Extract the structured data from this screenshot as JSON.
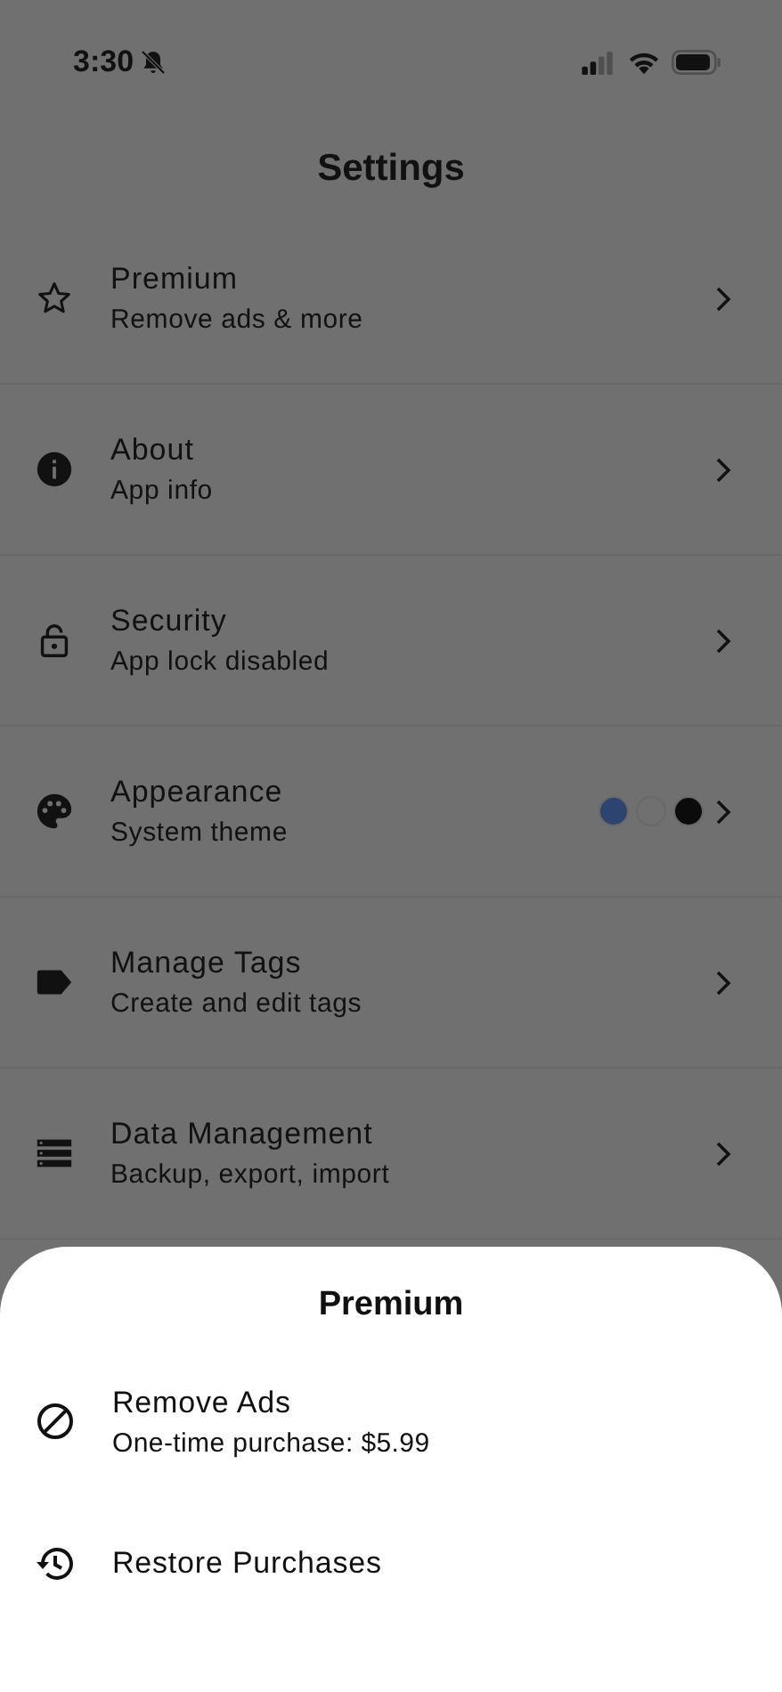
{
  "status_bar": {
    "time": "3:30"
  },
  "title": "Settings",
  "items": [
    {
      "title": "Premium",
      "subtitle": "Remove ads & more"
    },
    {
      "title": "About",
      "subtitle": "App info"
    },
    {
      "title": "Security",
      "subtitle": "App lock disabled"
    },
    {
      "title": "Appearance",
      "subtitle": "System theme",
      "swatches": [
        {
          "color": "#2e4470"
        },
        {
          "color": "#6f706f"
        },
        {
          "color": "#0b0b0b"
        }
      ]
    },
    {
      "title": "Manage Tags",
      "subtitle": "Create and edit tags"
    },
    {
      "title": "Data Management",
      "subtitle": "Backup, export, import"
    }
  ],
  "sheet": {
    "title": "Premium",
    "options": [
      {
        "title": "Remove Ads",
        "subtitle": "One-time purchase: $5.99"
      },
      {
        "title": "Restore Purchases"
      }
    ]
  }
}
